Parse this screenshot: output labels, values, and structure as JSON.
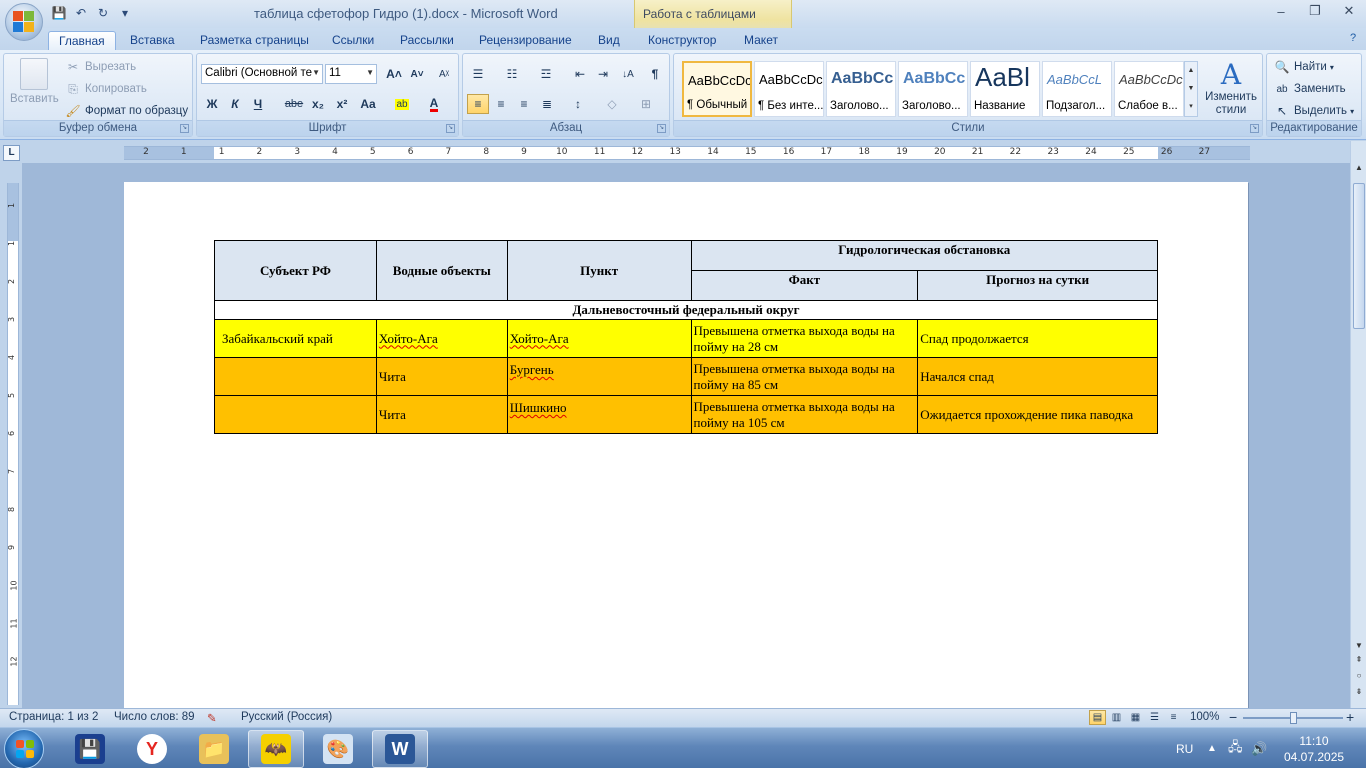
{
  "window": {
    "title": "таблица сфетофор Гидро (1).docx - Microsoft Word",
    "context_tab": "Работа с таблицами",
    "controls": {
      "minimize": "‒",
      "restore": "❐",
      "close": "✕"
    }
  },
  "quick_access": {
    "save": "💾",
    "undo": "↶",
    "redo": "↻",
    "more": "▾"
  },
  "tabs": [
    "Главная",
    "Вставка",
    "Разметка страницы",
    "Ссылки",
    "Рассылки",
    "Рецензирование",
    "Вид",
    "Конструктор",
    "Макет"
  ],
  "help": "?",
  "ribbon": {
    "clipboard": {
      "label": "Буфер обмена",
      "paste": "Вставить",
      "cut": "Вырезать",
      "copy": "Копировать",
      "format_painter": "Формат по образцу"
    },
    "font": {
      "label": "Шрифт",
      "font_name": "Calibri (Основной те",
      "font_size": "11",
      "grow": "A˄",
      "shrink": "A˅",
      "clear": "Aᵡ",
      "bold": "Ж",
      "italic": "К",
      "underline": "Ч",
      "strike": "abe",
      "subscript": "x₂",
      "superscript": "x²",
      "change_case": "Aa",
      "highlight": "ab",
      "font_color": "A"
    },
    "paragraph": {
      "label": "Абзац",
      "bullets": "☰",
      "numbering": "☷",
      "multilevel": "☲",
      "decrease_indent": "⇤",
      "increase_indent": "⇥",
      "sort": "↓A",
      "show_marks": "¶",
      "align_left": "≡",
      "center": "≡",
      "align_right": "≡",
      "justify": "≣",
      "line_spacing": "↕",
      "shading": "◇",
      "borders": "⊞"
    },
    "styles": {
      "label": "Стили",
      "change_styles": "Изменить стили",
      "items": [
        {
          "sample": "AaBbCcDc",
          "name": "¶ Обычный",
          "color": "#000000"
        },
        {
          "sample": "AaBbCcDc",
          "name": "¶ Без инте...",
          "color": "#000000"
        },
        {
          "sample": "AaBbCc",
          "name": "Заголово...",
          "color": "#365f91"
        },
        {
          "sample": "AaBbCc",
          "name": "Заголово...",
          "color": "#4f81bd"
        },
        {
          "sample": "AaBl",
          "name": "Название",
          "color": "#17365d"
        },
        {
          "sample": "AaBbCcL",
          "name": "Подзагол...",
          "color": "#4f81bd"
        },
        {
          "sample": "AaBbCcDc",
          "name": "Слабое в...",
          "color": "#404040"
        }
      ]
    },
    "editing": {
      "label": "Редактирование",
      "find": "Найти",
      "replace": "Заменить",
      "select": "Выделить"
    }
  },
  "ruler": {
    "corner": "L",
    "labels": [
      "2",
      "1",
      "1",
      "2",
      "3",
      "4",
      "5",
      "6",
      "7",
      "8",
      "9",
      "10",
      "11",
      "12",
      "13",
      "14",
      "15",
      "16",
      "17",
      "18",
      "19",
      "20",
      "21",
      "22",
      "23",
      "24",
      "25",
      "26",
      "27"
    ],
    "vlabels": [
      "1",
      "1",
      "2",
      "3",
      "4",
      "5",
      "6",
      "7",
      "8",
      "9",
      "10",
      "11",
      "12"
    ]
  },
  "table": {
    "headers": {
      "subject": "Субъект РФ",
      "water": "Водные объекты",
      "point": "Пункт",
      "hydro": "Гидрологическая обстановка",
      "fact": "Факт",
      "forecast": "Прогноз на сутки"
    },
    "region": "Дальневосточный федеральный округ",
    "rows": [
      {
        "subject": "Забайкальский край",
        "water": "Хойто-Ага",
        "point": "Хойто-Ага",
        "fact": "Превышена отметка выхода воды на пойму на 28 см",
        "forecast": "Спад продолжается",
        "color": "#ffff00"
      },
      {
        "subject": "",
        "water": "Чита",
        "point": "Бургень",
        "fact": "Превышена отметка выхода воды на пойму на 85 см",
        "forecast": "Начался спад",
        "color": "#ffc000"
      },
      {
        "subject": "",
        "water": "Чита",
        "point": "Шишкино",
        "fact": "Превышена отметка выхода воды на пойму на 105 см",
        "forecast": "Ожидается прохождение пика паводка",
        "color": "#ffc000"
      }
    ]
  },
  "statusbar": {
    "page": "Страница: 1 из 2",
    "words": "Число слов: 89",
    "language": "Русский (Россия)",
    "zoom": "100%",
    "zoom_minus": "−",
    "zoom_plus": "+"
  },
  "taskbar": {
    "apps": [
      {
        "name": "save-app",
        "glyph": "💾",
        "bg": "#1b3f8f"
      },
      {
        "name": "yandex-browser",
        "glyph": "Y",
        "bg": "#ffffff"
      },
      {
        "name": "file-explorer",
        "glyph": "📁",
        "bg": "#e8c15a"
      },
      {
        "name": "batman-app",
        "glyph": "🦇",
        "bg": "#f5d000"
      },
      {
        "name": "paint-app",
        "glyph": "🎨",
        "bg": "#d4e3f3"
      },
      {
        "name": "word-app",
        "glyph": "W",
        "bg": "#2b5797"
      }
    ],
    "lang": "RU",
    "time": "11:10",
    "date": "04.07.2025"
  }
}
